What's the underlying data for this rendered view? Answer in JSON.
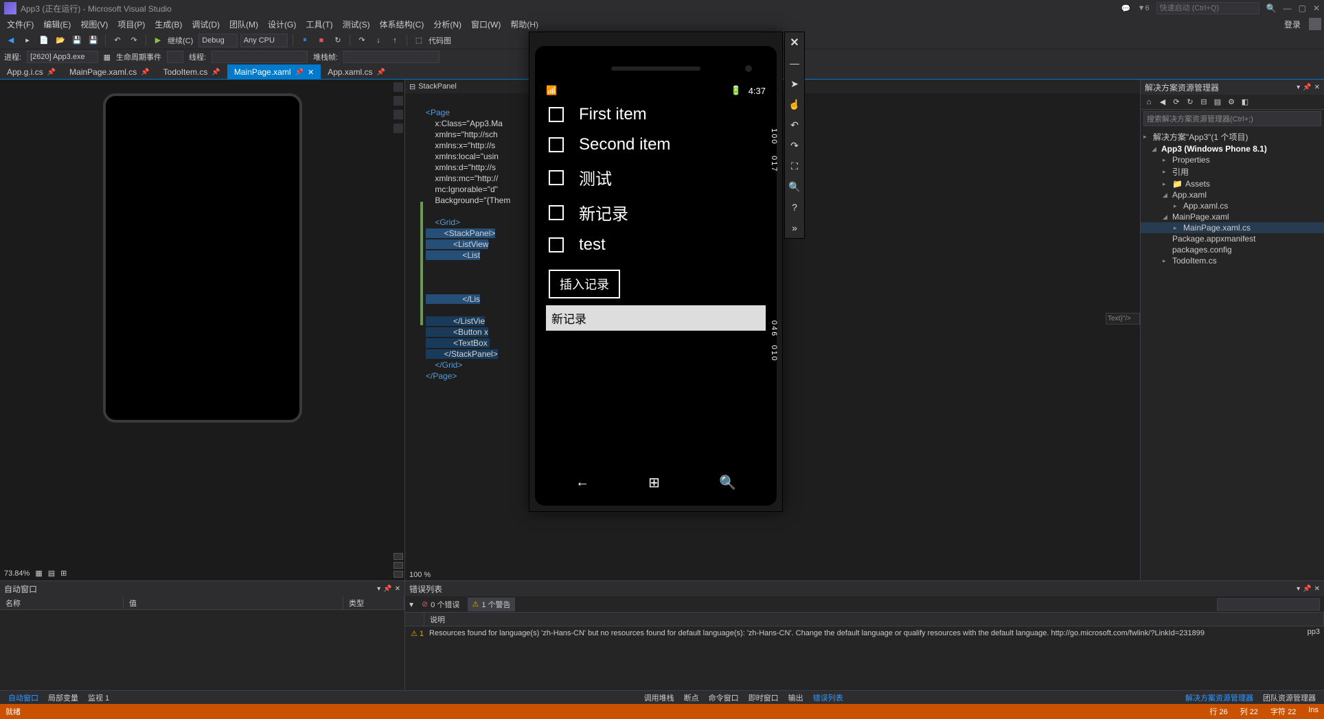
{
  "title": "App3 (正在运行) - Microsoft Visual Studio",
  "notifications": "▼6",
  "quick_launch_placeholder": "快速启动 (Ctrl+Q)",
  "login": "登录",
  "menu": [
    "文件(F)",
    "编辑(E)",
    "视图(V)",
    "项目(P)",
    "生成(B)",
    "调试(D)",
    "团队(M)",
    "设计(G)",
    "工具(T)",
    "测试(S)",
    "体系结构(C)",
    "分析(N)",
    "窗口(W)",
    "帮助(H)"
  ],
  "toolbar": {
    "continue": "继续(C)",
    "config": "Debug",
    "platform": "Any CPU",
    "code_view": "代码图"
  },
  "process": {
    "label": "进程:",
    "value": "[2620] App3.exe",
    "lifecycle_label": "生命周期事件",
    "thread_label": "线程:",
    "stack_label": "堆栈帧:"
  },
  "tabs": [
    {
      "label": "App.g.i.cs",
      "pinned": true,
      "active": false
    },
    {
      "label": "MainPage.xaml.cs",
      "pinned": true,
      "active": false
    },
    {
      "label": "TodoItem.cs",
      "pinned": true,
      "active": false
    },
    {
      "label": "MainPage.xaml",
      "pinned": true,
      "active": true
    },
    {
      "label": "App.xaml.cs",
      "pinned": true,
      "active": false
    }
  ],
  "designer": {
    "zoom": "73.84%"
  },
  "code": {
    "outline": "StackPanel",
    "zoom": "100 %",
    "lines": {
      "l1": "<Page",
      "l2": "    x:Class=\"App3.Ma",
      "l3": "    xmlns=\"http://sch",
      "l4": "    xmlns:x=\"http://s",
      "l5": "    xmlns:local=\"usin",
      "l6": "    xmlns:d=\"http://s",
      "l7": "    xmlns:mc=\"http://",
      "l8": "    mc:Ignorable=\"d\"",
      "l9": "    Background=\"{Them",
      "l10": "",
      "l11": "    <Grid>",
      "l12": "        <StackPanel>",
      "l13": "            <ListView",
      "l14": "                <List",
      "l15": "",
      "l16": "",
      "l17": "",
      "l18": "                </Lis",
      "l19": "",
      "l20": "            </ListVie",
      "l21": "            <Button x",
      "l22": "            <TextBox ",
      "l23": "        </StackPanel>",
      "l24": "    </Grid>",
      "l25": "</Page>"
    }
  },
  "code_strip": "Text}\"/>",
  "solution_explorer": {
    "title": "解决方案资源管理器",
    "search_placeholder": "搜索解决方案资源管理器(Ctrl+;)",
    "root": "解决方案\"App3\"(1 个项目)",
    "project": "App3 (Windows Phone 8.1)",
    "nodes": {
      "properties": "Properties",
      "references": "引用",
      "assets": "Assets",
      "app_xaml": "App.xaml",
      "app_xaml_cs": "App.xaml.cs",
      "mainpage_xaml": "MainPage.xaml",
      "mainpage_xaml_cs": "MainPage.xaml.cs",
      "package": "Package.appxmanifest",
      "packages_config": "packages.config",
      "todoitem": "TodoItem.cs"
    }
  },
  "autos": {
    "title": "自动窗口",
    "cols": {
      "name": "名称",
      "value": "值",
      "type": "类型"
    }
  },
  "errors": {
    "title": "错误列表",
    "filters": {
      "errors": "0 个错误",
      "warnings": "1 个警告"
    },
    "cols": {
      "desc": "说明"
    },
    "row1": "Resources found for language(s) 'zh-Hans-CN' but no resources found for default language(s): 'zh-Hans-CN'. Change the default language or qualify resources with the default language. http://go.microsoft.com/fwlink/?LinkId=231899",
    "extra": "pp3"
  },
  "bottom_tabs": {
    "left": [
      "自动窗口",
      "局部变量",
      "监视 1"
    ],
    "mid": [
      "调用堆栈",
      "断点",
      "命令窗口",
      "即时窗口",
      "输出",
      "错误列表"
    ],
    "right": [
      "解决方案资源管理器",
      "团队资源管理器"
    ]
  },
  "status": {
    "ready": "就绪",
    "line": "行 26",
    "col": "列 22",
    "char": "字符 22",
    "ins": "Ins"
  },
  "emulator": {
    "time": "4:37",
    "items": [
      "First item",
      "Second item",
      "测试",
      "新记录",
      "test"
    ],
    "button": "插入记录",
    "input_value": "新记录",
    "side_labels": [
      "100",
      "017",
      "046",
      "010"
    ]
  }
}
